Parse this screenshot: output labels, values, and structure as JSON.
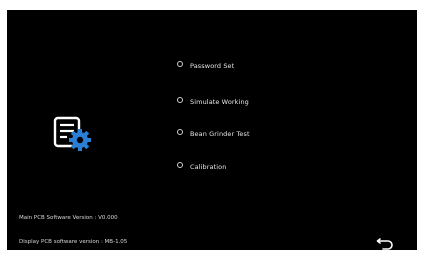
{
  "menu": {
    "items": [
      {
        "label": "Password Set"
      },
      {
        "label": "Simulate Working"
      },
      {
        "label": "Bean Grinder Test"
      },
      {
        "label": "Calibration"
      }
    ]
  },
  "versions": {
    "main_pcb": "Main PCB Software Version : V0.000",
    "display_pcb": "Display PCB software version : MB-1.05"
  },
  "icons": {
    "settings": "document-gear-icon",
    "back": "back-arrow-icon"
  },
  "colors": {
    "background": "#000000",
    "icon_accent": "#2a7fd4",
    "text": "#e6e6e6"
  }
}
